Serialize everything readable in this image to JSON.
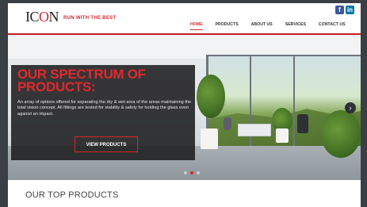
{
  "social": {
    "facebook": "f",
    "linkedin": "in"
  },
  "brand": {
    "logo_prefix": "IC",
    "logo_o": "O",
    "logo_suffix": "N",
    "tagline": "RUN WITH THE BEST"
  },
  "nav": {
    "items": [
      {
        "label": "HOME",
        "active": true
      },
      {
        "label": "PRODUCTS",
        "active": false
      },
      {
        "label": "ABOUT US",
        "active": false
      },
      {
        "label": "SERVICES",
        "active": false
      },
      {
        "label": "CONTACT US",
        "active": false
      }
    ]
  },
  "hero": {
    "title": "OUR SPECTRUM OF PRODUCTS:",
    "text": "An array of options offered for separating the dry & wet area of the areas maintaining the total vision concept. All fittings are tested for stability & safety for holding the glass even against an impact.",
    "cta_label": "VIEW PRODUCTS",
    "slides": 3,
    "active_slide": 1
  },
  "section": {
    "title": "OUR TOP PRODUCTS"
  },
  "colors": {
    "brand_red": "#d7262b",
    "overlay": "#1c1c1e"
  }
}
